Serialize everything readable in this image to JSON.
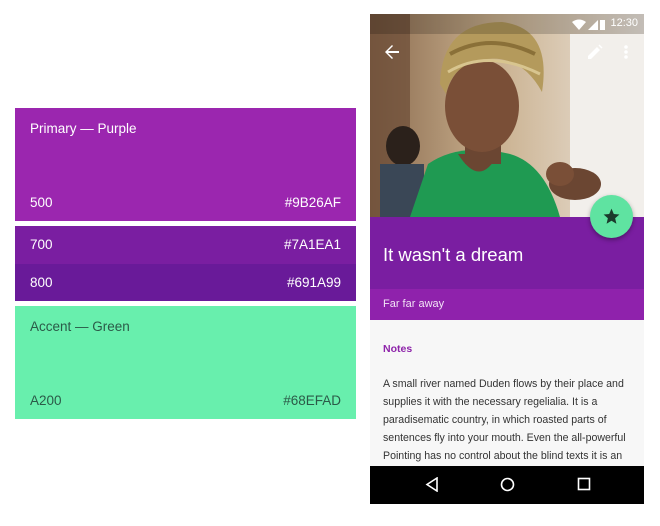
{
  "palette": {
    "primary": {
      "title": "Primary — Purple",
      "name": "500",
      "hex": "#9B26AF"
    },
    "primary_700": {
      "name": "700",
      "hex": "#7A1EA1"
    },
    "primary_800": {
      "name": "800",
      "hex": "#691A99"
    },
    "accent": {
      "title": "Accent — Green",
      "name": "A200",
      "hex": "#68EFAD"
    }
  },
  "phone": {
    "status_time": "12:30",
    "icons": {
      "back": "arrow-back-icon",
      "edit": "pencil-icon",
      "menu": "more-vert-icon",
      "fab": "star-icon",
      "nav_back": "triangle-back-icon",
      "nav_home": "circle-home-icon",
      "nav_recents": "square-recents-icon"
    },
    "title": "It wasn't a dream",
    "subtitle": "Far far away",
    "notes_heading": "Notes",
    "body": "A small river named Duden flows by their place and supplies it with the necessary regelialia. It is a paradisematic country, in which roasted parts of sentences fly into your mouth. Even the all-powerful Pointing has no control about the blind texts it is an"
  }
}
